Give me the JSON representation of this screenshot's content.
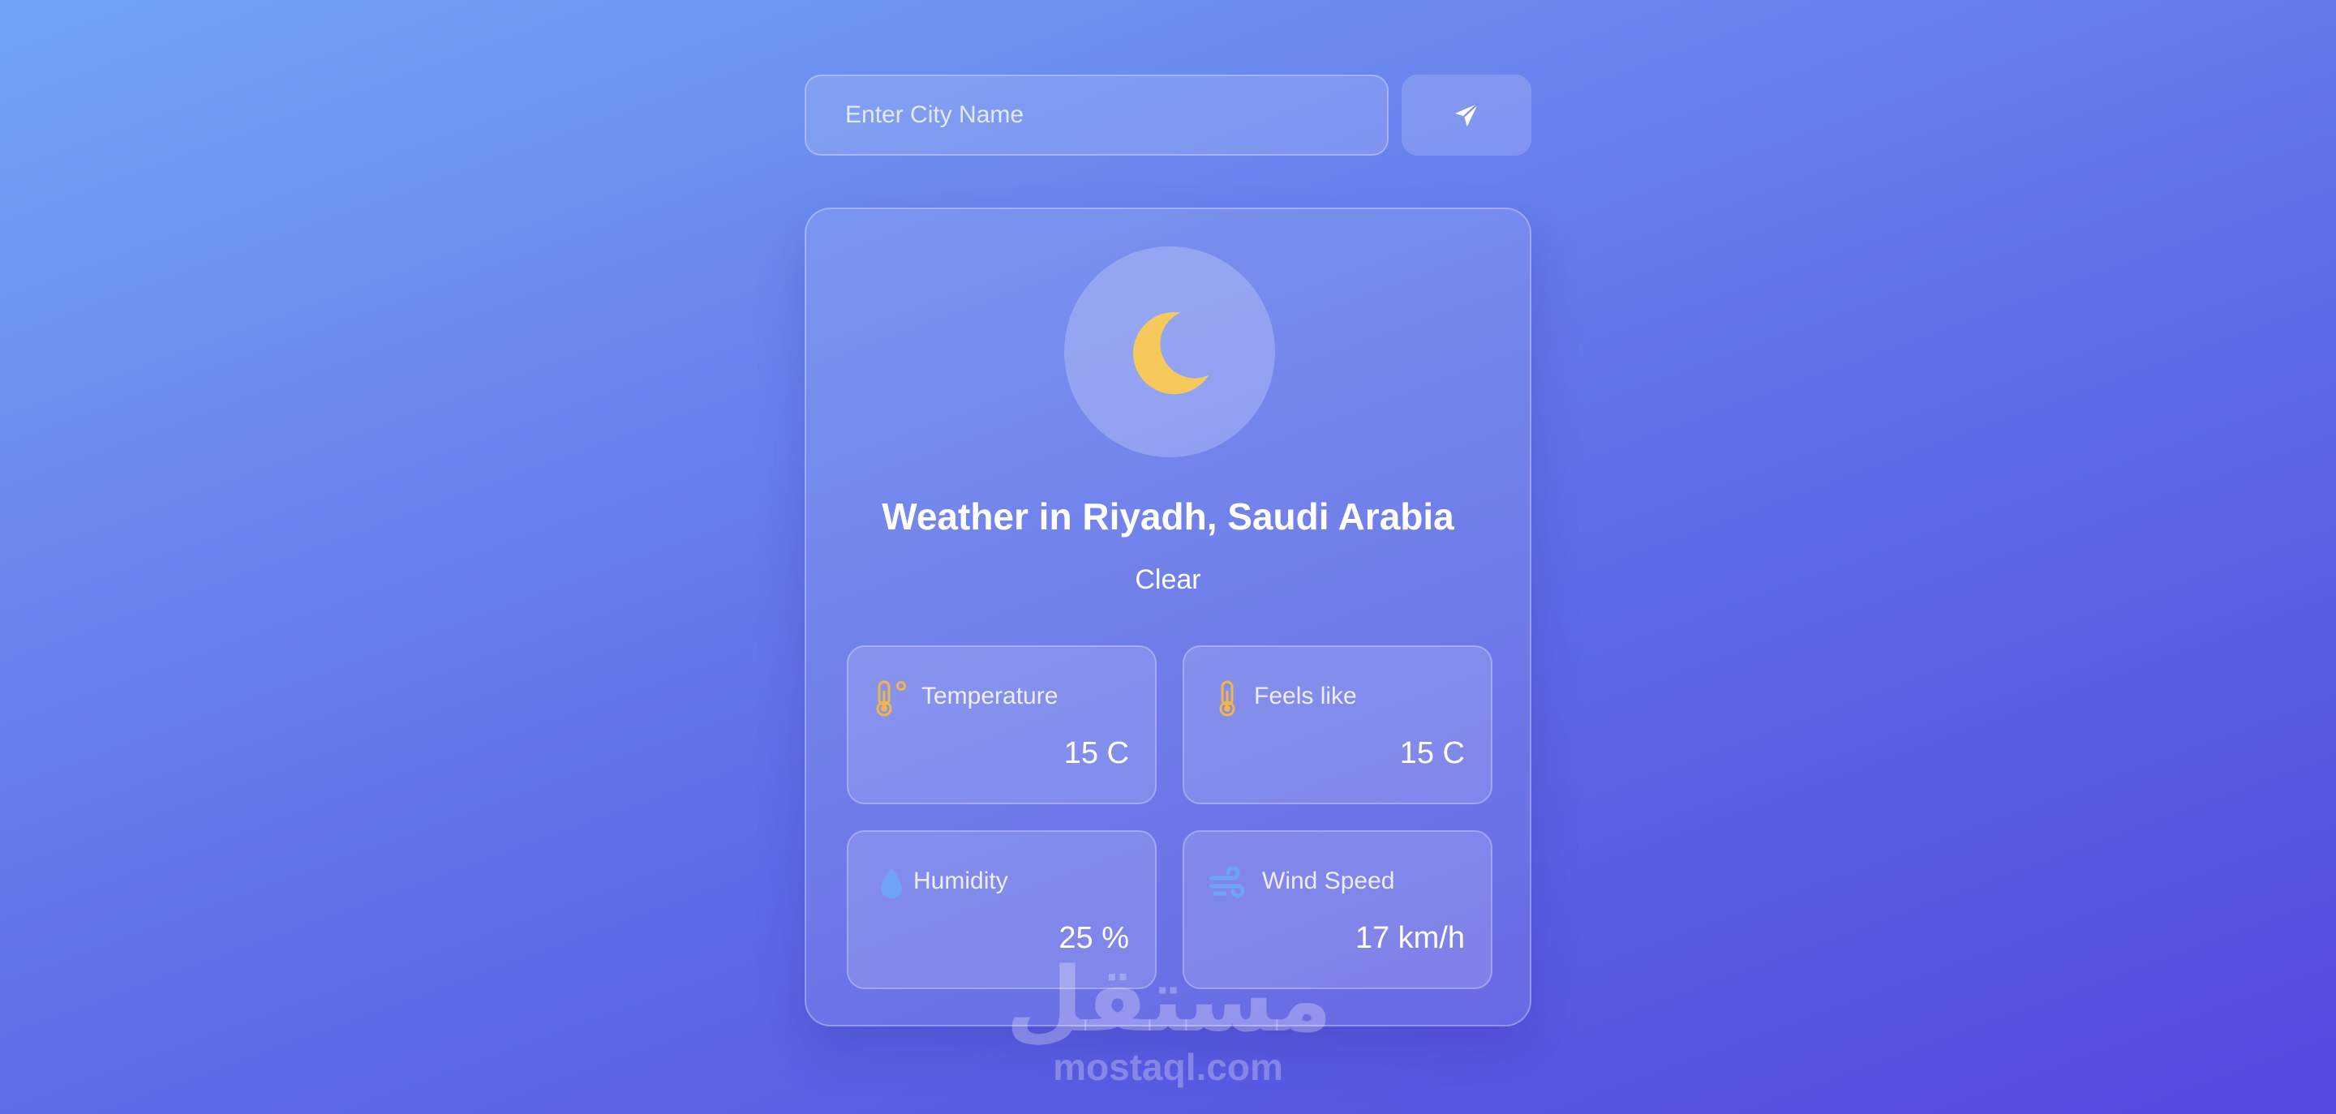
{
  "search": {
    "placeholder": "Enter City Name",
    "value": "",
    "submit_icon": "paper-plane-icon"
  },
  "weather": {
    "icon": "crescent-moon-icon",
    "title": "Weather in Riyadh, Saudi Arabia",
    "condition": "Clear"
  },
  "stats": {
    "temperature": {
      "label": "Temperature",
      "value": "15 C",
      "icon": "thermometer-degree-icon"
    },
    "feels_like": {
      "label": "Feels like",
      "value": "15 C",
      "icon": "thermometer-icon"
    },
    "humidity": {
      "label": "Humidity",
      "value": "25 %",
      "icon": "water-drop-icon"
    },
    "wind_speed": {
      "label": "Wind Speed",
      "value": "17 km/h",
      "icon": "wind-icon"
    }
  },
  "watermark": {
    "arabic": "مستقل",
    "latin": "mostaql.com"
  },
  "colors": {
    "moon": "#f5c95c",
    "stat_icon_warm": "#f0b64a",
    "stat_icon_cool": "#6ea3f5",
    "background_start": "#72a4f5",
    "background_end": "#5448e0"
  }
}
